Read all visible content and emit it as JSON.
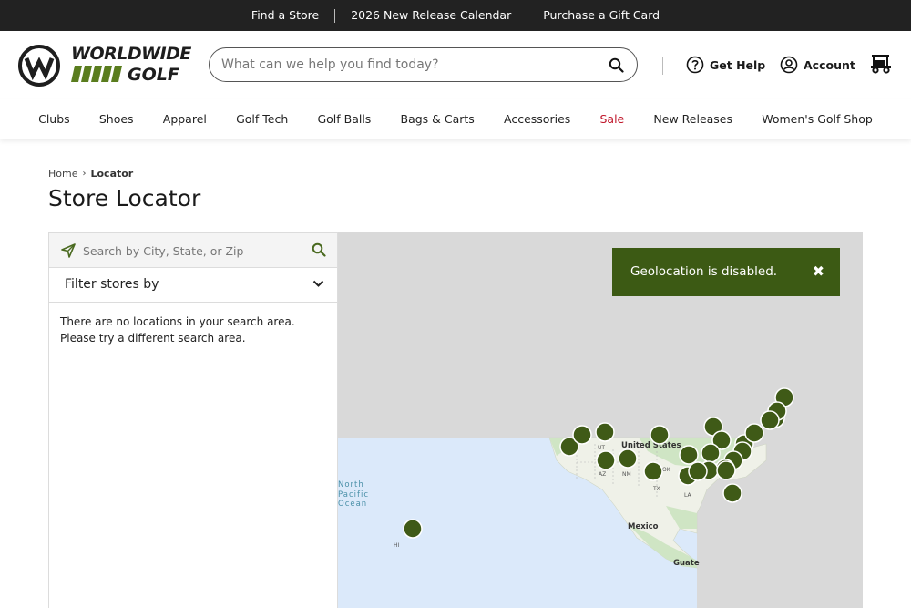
{
  "topbar": {
    "links": [
      "Find a Store",
      "2026 New Release Calendar",
      "Purchase a Gift Card"
    ]
  },
  "brand": {
    "line1": "WORLDWIDE",
    "line2": "GOLF"
  },
  "header": {
    "search_placeholder": "What can we help you find today?",
    "help_label": "Get Help",
    "account_label": "Account"
  },
  "nav": {
    "items": [
      "Clubs",
      "Shoes",
      "Apparel",
      "Golf Tech",
      "Golf Balls",
      "Bags & Carts",
      "Accessories",
      "Sale",
      "New Releases",
      "Women's Golf Shop"
    ]
  },
  "breadcrumb": {
    "home": "Home",
    "current": "Locator"
  },
  "page": {
    "title": "Store Locator"
  },
  "locator": {
    "search_placeholder": "Search by City, State, or Zip",
    "filter_label": "Filter stores by",
    "empty_message": "There are no locations in your search area. Please try a different search area."
  },
  "map": {
    "labels": {
      "ocean": [
        "North",
        "Pacific",
        "Ocean"
      ],
      "usa": "United States",
      "mexico": "Mexico",
      "guate": "Guate",
      "hi": "HI",
      "states": [
        "UT",
        "AZ",
        "NM",
        "OK",
        "TX",
        "LA"
      ]
    },
    "toast": "Geolocation is disabled.",
    "toast_close": "✖",
    "marker_color": "#3f5a17"
  },
  "colors": {
    "accent": "#3c5a14",
    "sale": "#c0172b",
    "topbar": "#222222"
  }
}
